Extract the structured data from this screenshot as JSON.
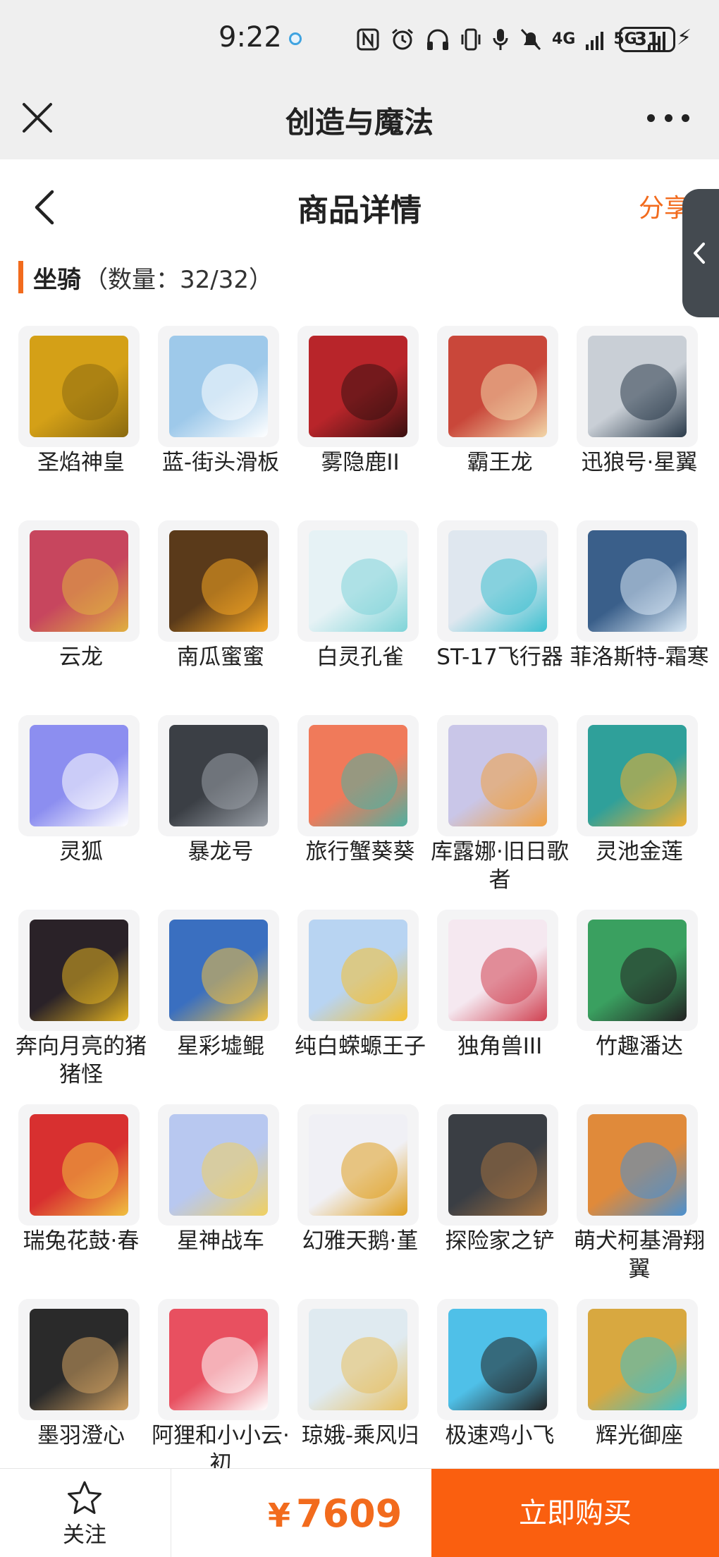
{
  "status_bar": {
    "time": "9:22",
    "network_label": "4G",
    "network2_label": "5G",
    "battery": "31"
  },
  "app_bar": {
    "title": "创造与魔法"
  },
  "header": {
    "title": "商品详情",
    "share_label": "分享"
  },
  "section": {
    "name": "坐骑",
    "count": "（数量：32/32）"
  },
  "colors": {
    "accent": "#f26b1d",
    "buy_button": "#fa5f0f"
  },
  "items": [
    {
      "name": "圣焰神皇",
      "icon": "golden-dragon-mount",
      "color": "#d4a017",
      "color2": "#8a6a10"
    },
    {
      "name": "蓝-街头滑板",
      "icon": "skateboard-mount",
      "color": "#9ec9ea",
      "color2": "#ffffff"
    },
    {
      "name": "雾隐鹿II",
      "icon": "red-deer-mount",
      "color": "#b8252a",
      "color2": "#3a1010"
    },
    {
      "name": "霸王龙",
      "icon": "trex-mount",
      "color": "#c9473a",
      "color2": "#f2d6a8"
    },
    {
      "name": "迅狼号·星翼",
      "icon": "mech-wolf-mount",
      "color": "#c9cfd6",
      "color2": "#2a3a4a"
    },
    {
      "name": "云龙",
      "icon": "cloud-dragon-mount",
      "color": "#c7465e",
      "color2": "#e0b040"
    },
    {
      "name": "南瓜蜜蜜",
      "icon": "bee-mount",
      "color": "#5a3a1a",
      "color2": "#f5a623"
    },
    {
      "name": "白灵孔雀",
      "icon": "white-peacock-mount",
      "color": "#e6f2f5",
      "color2": "#7fd4d8"
    },
    {
      "name": "ST-17飞行器",
      "icon": "aircraft-mount",
      "color": "#dfe7ef",
      "color2": "#3cc0d0"
    },
    {
      "name": "菲洛斯特-霜寒",
      "icon": "frost-rider-mount",
      "color": "#3a5f8a",
      "color2": "#d8e8f5"
    },
    {
      "name": "灵狐",
      "icon": "spirit-fox-mount",
      "color": "#8c8ef0",
      "color2": "#ffffff"
    },
    {
      "name": "暴龙号",
      "icon": "mech-raptor-mount",
      "color": "#3b3f45",
      "color2": "#9aa0a8"
    },
    {
      "name": "旅行蟹葵葵",
      "icon": "crab-mount",
      "color": "#f07a5a",
      "color2": "#4fb0a0"
    },
    {
      "name": "库露娜·旧日歌者",
      "icon": "siren-mount",
      "color": "#c9c6e8",
      "color2": "#f0a040"
    },
    {
      "name": "灵池金莲",
      "icon": "golden-lotus-mount",
      "color": "#2fa09a",
      "color2": "#f0b030"
    },
    {
      "name": "奔向月亮的猪猪怪",
      "icon": "pig-mount",
      "color": "#2a2228",
      "color2": "#e0b020"
    },
    {
      "name": "星彩墟鲲",
      "icon": "star-whale-mount",
      "color": "#3a6fc0",
      "color2": "#f0c040"
    },
    {
      "name": "纯白蝾螈王子",
      "icon": "axolotl-mount",
      "color": "#b8d4f2",
      "color2": "#f5c030"
    },
    {
      "name": "独角兽III",
      "icon": "unicorn-mount",
      "color": "#f5e8f0",
      "color2": "#d04050"
    },
    {
      "name": "竹趣潘达",
      "icon": "panda-mount",
      "color": "#3aa060",
      "color2": "#222222"
    },
    {
      "name": "瑞兔花鼓·春",
      "icon": "drum-mount",
      "color": "#d83030",
      "color2": "#f0c040"
    },
    {
      "name": "星神战车",
      "icon": "star-chariot-mount",
      "color": "#b8c8f0",
      "color2": "#f0d060"
    },
    {
      "name": "幻雅天鹅·堇",
      "icon": "swan-mount",
      "color": "#f0f0f5",
      "color2": "#e0a020"
    },
    {
      "name": "探险家之铲",
      "icon": "shovel-mount",
      "color": "#3a3e44",
      "color2": "#a07040"
    },
    {
      "name": "萌犬柯基滑翔翼",
      "icon": "corgi-glider-mount",
      "color": "#e08a3a",
      "color2": "#4a90d0"
    },
    {
      "name": "墨羽澄心",
      "icon": "ink-feather-mount",
      "color": "#2a2a2a",
      "color2": "#d0a060"
    },
    {
      "name": "阿狸和小小云·初",
      "icon": "ali-cloud-mount",
      "color": "#e85060",
      "color2": "#ffffff"
    },
    {
      "name": "琼娥-乘风归",
      "icon": "fairy-mount",
      "color": "#dfeaf0",
      "color2": "#e8c060"
    },
    {
      "name": "极速鸡小飞",
      "icon": "chick-mount",
      "color": "#4fc0e8",
      "color2": "#222222"
    },
    {
      "name": "辉光御座",
      "icon": "throne-mount",
      "color": "#d8a840",
      "color2": "#40c0c8"
    }
  ],
  "bottom_bar": {
    "follow_label": "关注",
    "currency": "¥",
    "price": "7609",
    "buy_label": "立即购买"
  }
}
